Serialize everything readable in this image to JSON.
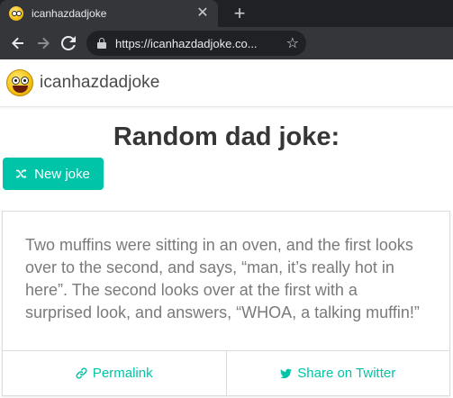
{
  "browser": {
    "tab_title": "icanhazdadjoke",
    "url": "https://icanhazdadjoke.co..."
  },
  "site": {
    "name": "icanhazdadjoke",
    "heading": "Random dad joke:",
    "new_joke_label": "New joke",
    "joke": "Two muffins were sitting in an oven, and the first looks over to the second, and says, “man, it’s really hot in here”. The second looks over at the first with a surprised look, and answers, “WHOA, a talking muffin!”",
    "permalink_label": "Permalink",
    "share_label": "Share on Twitter"
  },
  "colors": {
    "accent": "#00c4a7",
    "heading": "#363636",
    "joke_text": "#7a7a7a"
  },
  "icons": [
    "smiley-favicon-icon",
    "close-icon",
    "plus-icon",
    "back-arrow-icon",
    "forward-arrow-icon",
    "reload-icon",
    "lock-icon",
    "star-icon",
    "shuffle-icon",
    "link-icon",
    "twitter-icon"
  ]
}
